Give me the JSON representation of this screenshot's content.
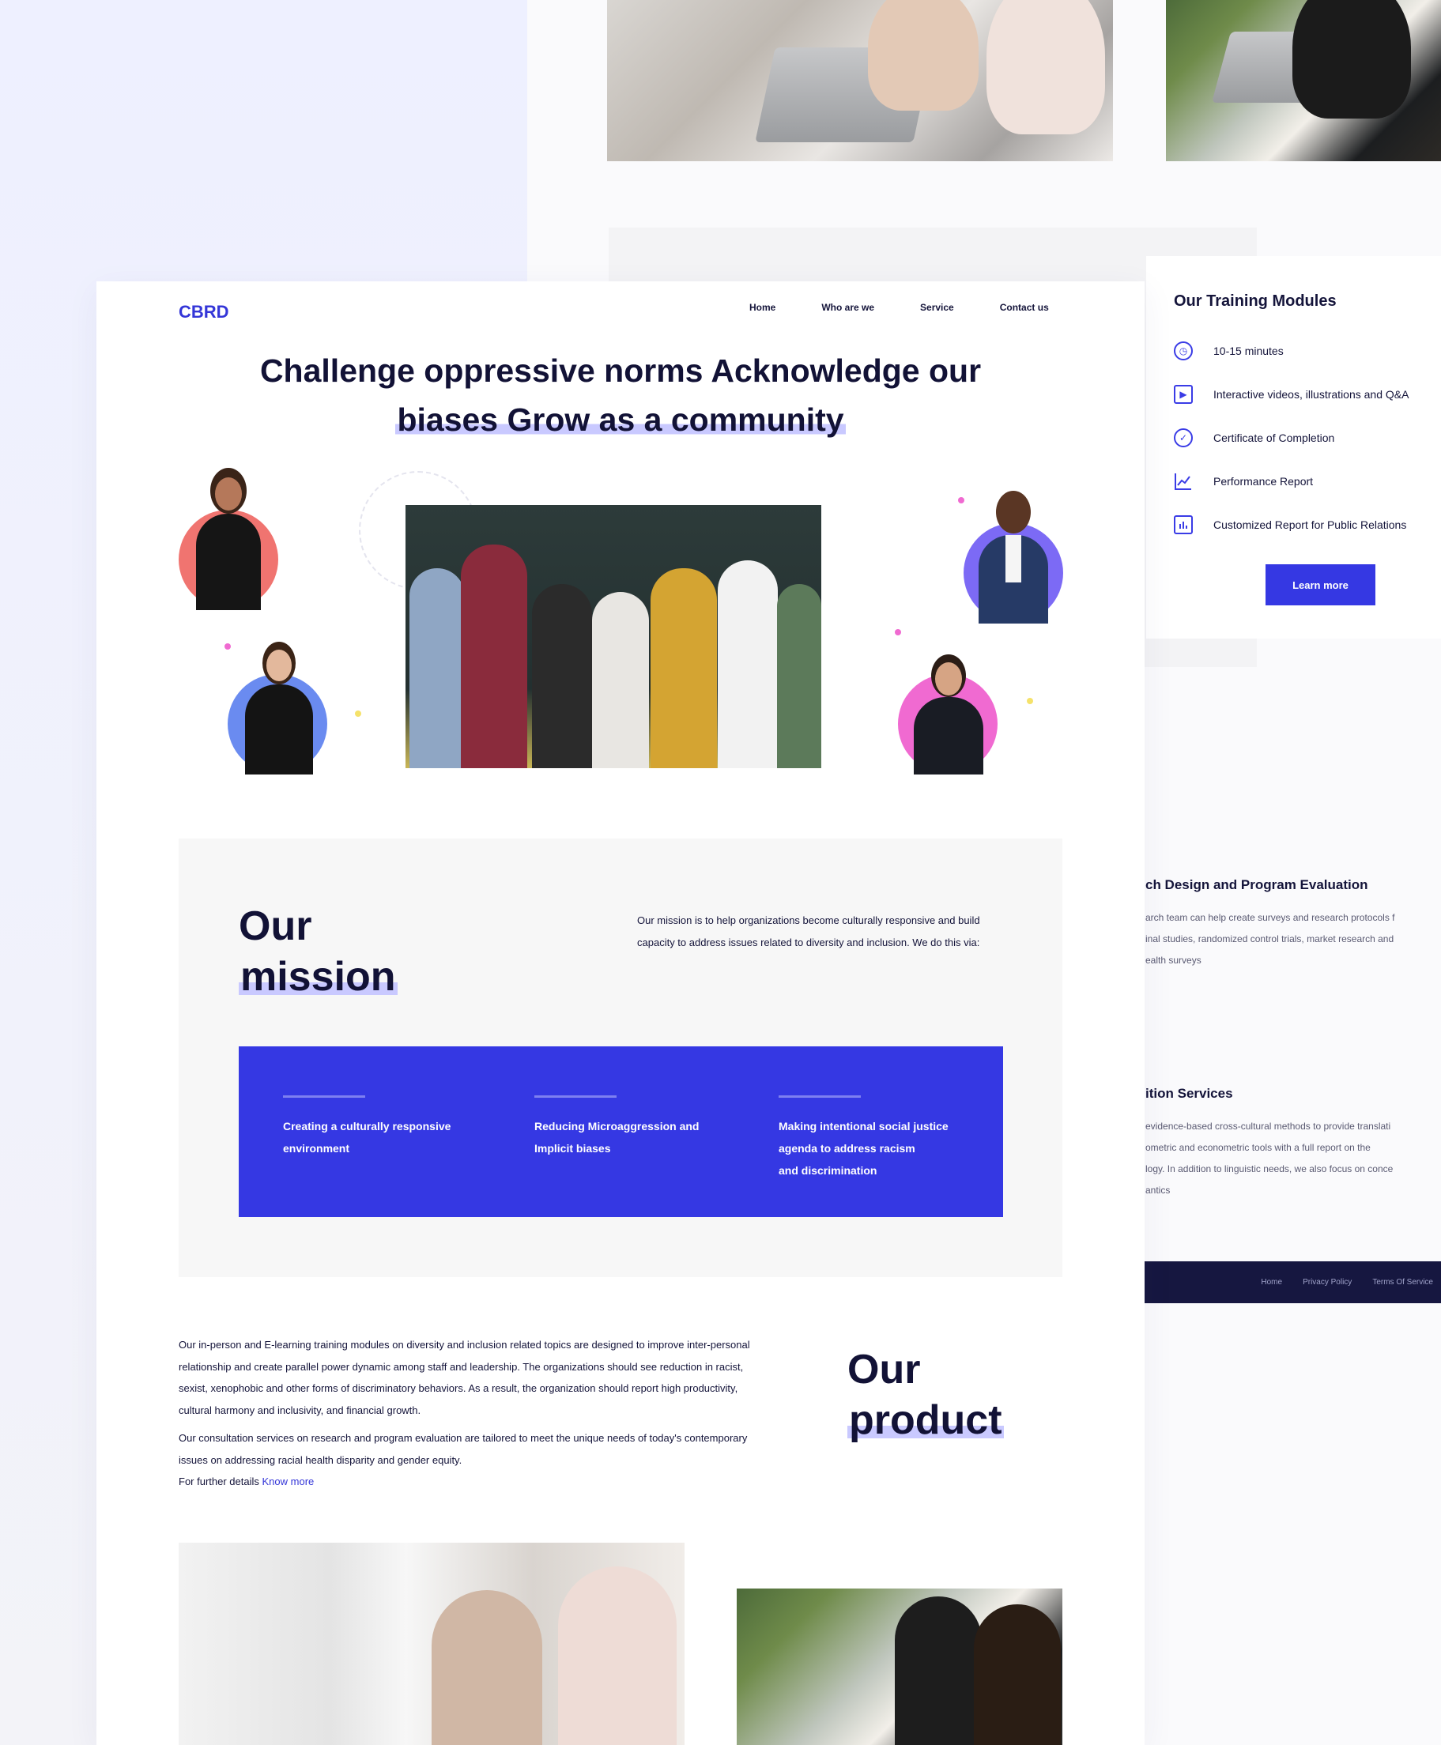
{
  "brand": {
    "logo": "CBRD",
    "accent": "#3538e3",
    "dark": "#161740"
  },
  "nav": {
    "items": [
      "Home",
      "Who are we",
      "Service",
      "Contact us"
    ]
  },
  "hero": {
    "line1": "Challenge oppressive norms Acknowledge our",
    "line2": "biases Grow as a community"
  },
  "mission": {
    "heading_1": "Our",
    "heading_2": "mission",
    "text": "Our mission is to help organizations become culturally responsive and build capacity to address issues related to diversity and inclusion. We do this via:",
    "items": [
      {
        "line1": "Creating a culturally responsive",
        "line2": "environment"
      },
      {
        "line1": "Reducing Microaggression and",
        "line2": "Implicit biases"
      },
      {
        "line1": "Making intentional social justice",
        "line2": "agenda to address racism",
        "line3": "and discrimination"
      }
    ]
  },
  "product": {
    "heading_1": "Our",
    "heading_2": "product",
    "para1": "Our in-person and E-learning training modules on diversity and inclusion related topics are designed to improve inter-personal relationship and create parallel power dynamic among staff and leadership. The organizations should see reduction in racist, sexist, xenophobic and other forms of discriminatory behaviors. As a result, the organization should report high productivity, cultural harmony and inclusivity, and financial growth.",
    "para2": "Our consultation services on research and program evaluation are tailored to meet the unique needs of today's contemporary issues on addressing racial health disparity and gender equity.",
    "more_prefix": "For further details",
    "more_link": "Know more"
  },
  "training": {
    "title": "Our Training Modules",
    "items": [
      {
        "icon": "clock-icon",
        "label": "10-15 minutes"
      },
      {
        "icon": "play-icon",
        "label": "Interactive videos, illustrations and Q&A"
      },
      {
        "icon": "check-circle-icon",
        "label": "Certificate of Completion"
      },
      {
        "icon": "chart-line-icon",
        "label": "Performance Report"
      },
      {
        "icon": "report-icon",
        "label": "Customized Report for Public Relations"
      }
    ],
    "button": "Learn more"
  },
  "services": [
    {
      "title": "ch Design and Program Evaluation",
      "lines": [
        "arch team can help create surveys and research protocols f",
        "inal studies, randomized control trials, market research and",
        "ealth surveys"
      ]
    },
    {
      "title": "ition Services",
      "lines": [
        "evidence-based cross-cultural methods to provide translati",
        "ometric and econometric tools with a full report on the",
        "logy. In addition to linguistic needs, we also focus on conce",
        "antics"
      ]
    }
  ],
  "footer": {
    "links": [
      "Home",
      "Privacy Policy",
      "Terms Of Service"
    ]
  }
}
